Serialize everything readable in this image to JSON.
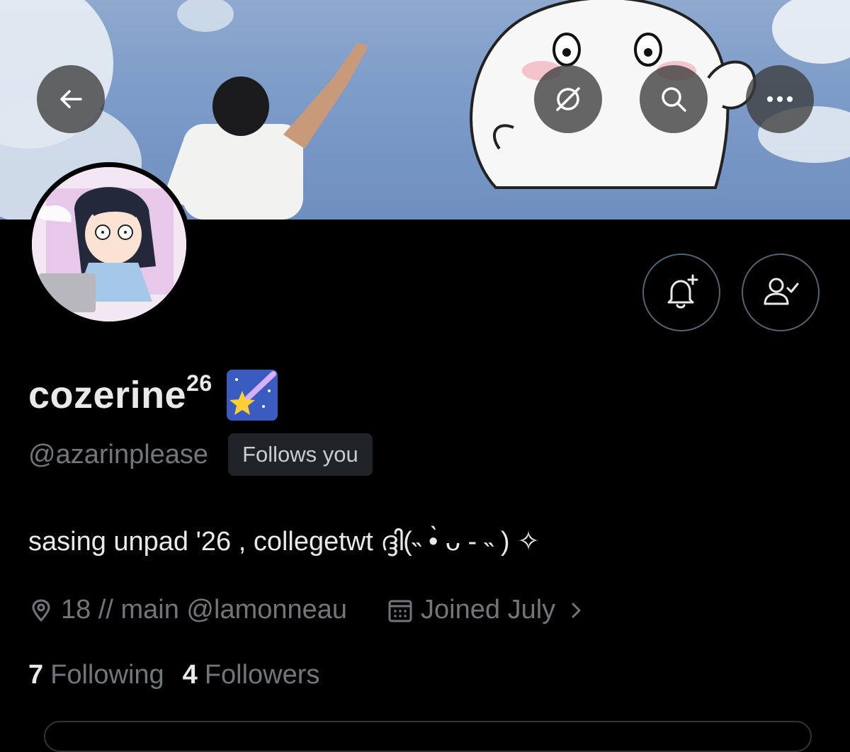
{
  "profile": {
    "display_name": "cozerine",
    "display_name_sup": "26",
    "name_emoji": "shooting-star-emoji",
    "handle": "@azarinplease",
    "follows_you": "Follows you",
    "bio": "sasing unpad '26 , collegetwt  ദ്ദി(˵ •̀ ᴗ - ˵ ) ✧",
    "location": "18 // main @lamonneau",
    "joined": "Joined July",
    "following_count": "7",
    "following_label": "Following",
    "followers_count": "4",
    "followers_label": "Followers"
  },
  "icons": {
    "back": "back-arrow-icon",
    "translate": "grok-icon",
    "search": "search-icon",
    "more": "more-icon",
    "notify": "bell-plus-icon",
    "follow": "person-check-icon",
    "location": "location-pin-icon",
    "calendar": "calendar-icon",
    "chevron": "chevron-right-icon"
  },
  "colors": {
    "background": "#000000",
    "text_primary": "#e7e9ea",
    "text_secondary": "#71767b",
    "badge_bg": "#202327"
  }
}
